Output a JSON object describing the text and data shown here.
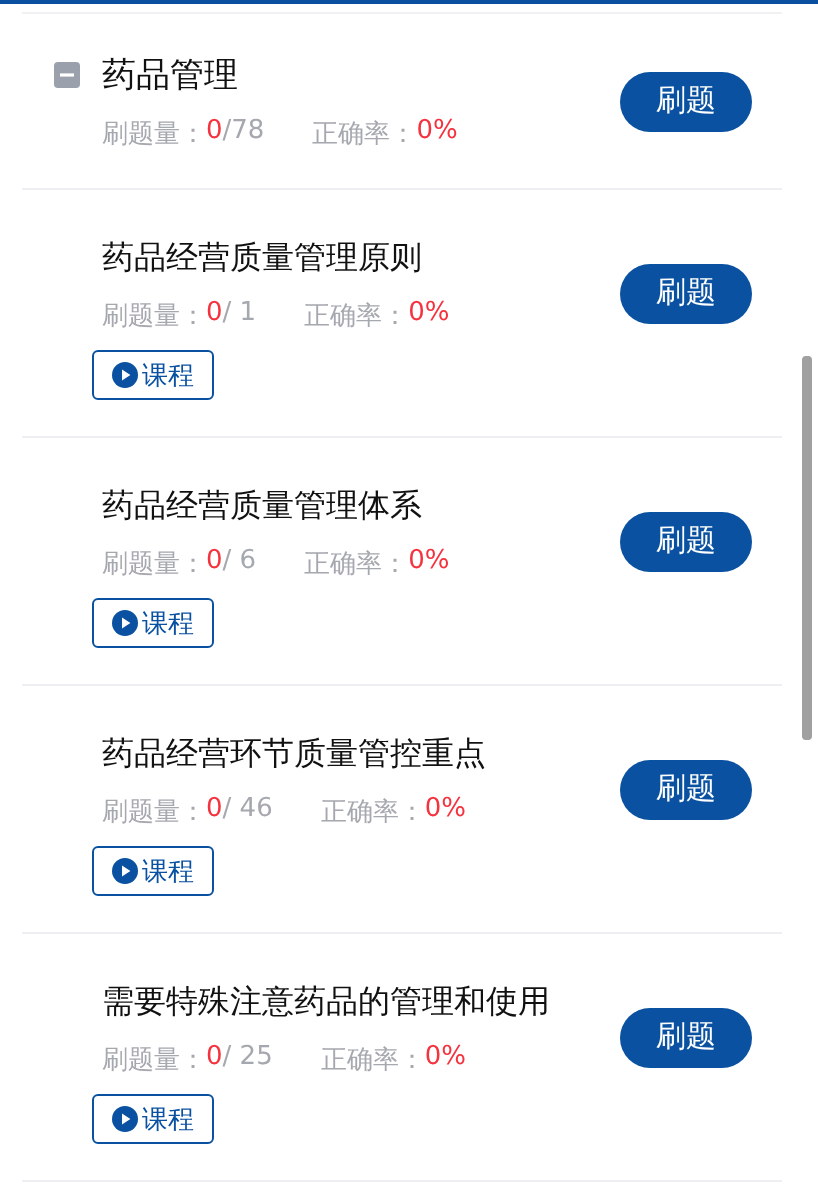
{
  "group": {
    "title": "药品管理",
    "expanded": true,
    "count_label": "刷题量：",
    "done": "0",
    "total": "/78",
    "rate_label": "正确率：",
    "rate": "0%",
    "practice_button": "刷题"
  },
  "items": [
    {
      "title": "药品经营质量管理原则",
      "count_label": "刷题量：",
      "done": "0",
      "total": "/ 1",
      "rate_label": "正确率：",
      "rate": "0%",
      "course_button": "课程",
      "practice_button": "刷题"
    },
    {
      "title": "药品经营质量管理体系",
      "count_label": "刷题量：",
      "done": "0",
      "total": "/ 6",
      "rate_label": "正确率：",
      "rate": "0%",
      "course_button": "课程",
      "practice_button": "刷题"
    },
    {
      "title": "药品经营环节质量管控重点",
      "count_label": "刷题量：",
      "done": "0",
      "total": "/ 46",
      "rate_label": "正确率：",
      "rate": "0%",
      "course_button": "课程",
      "practice_button": "刷题"
    },
    {
      "title": "需要特殊注意药品的管理和使用",
      "count_label": "刷题量：",
      "done": "0",
      "total": "/ 25",
      "rate_label": "正确率：",
      "rate": "0%",
      "course_button": "课程",
      "practice_button": "刷题"
    }
  ]
}
